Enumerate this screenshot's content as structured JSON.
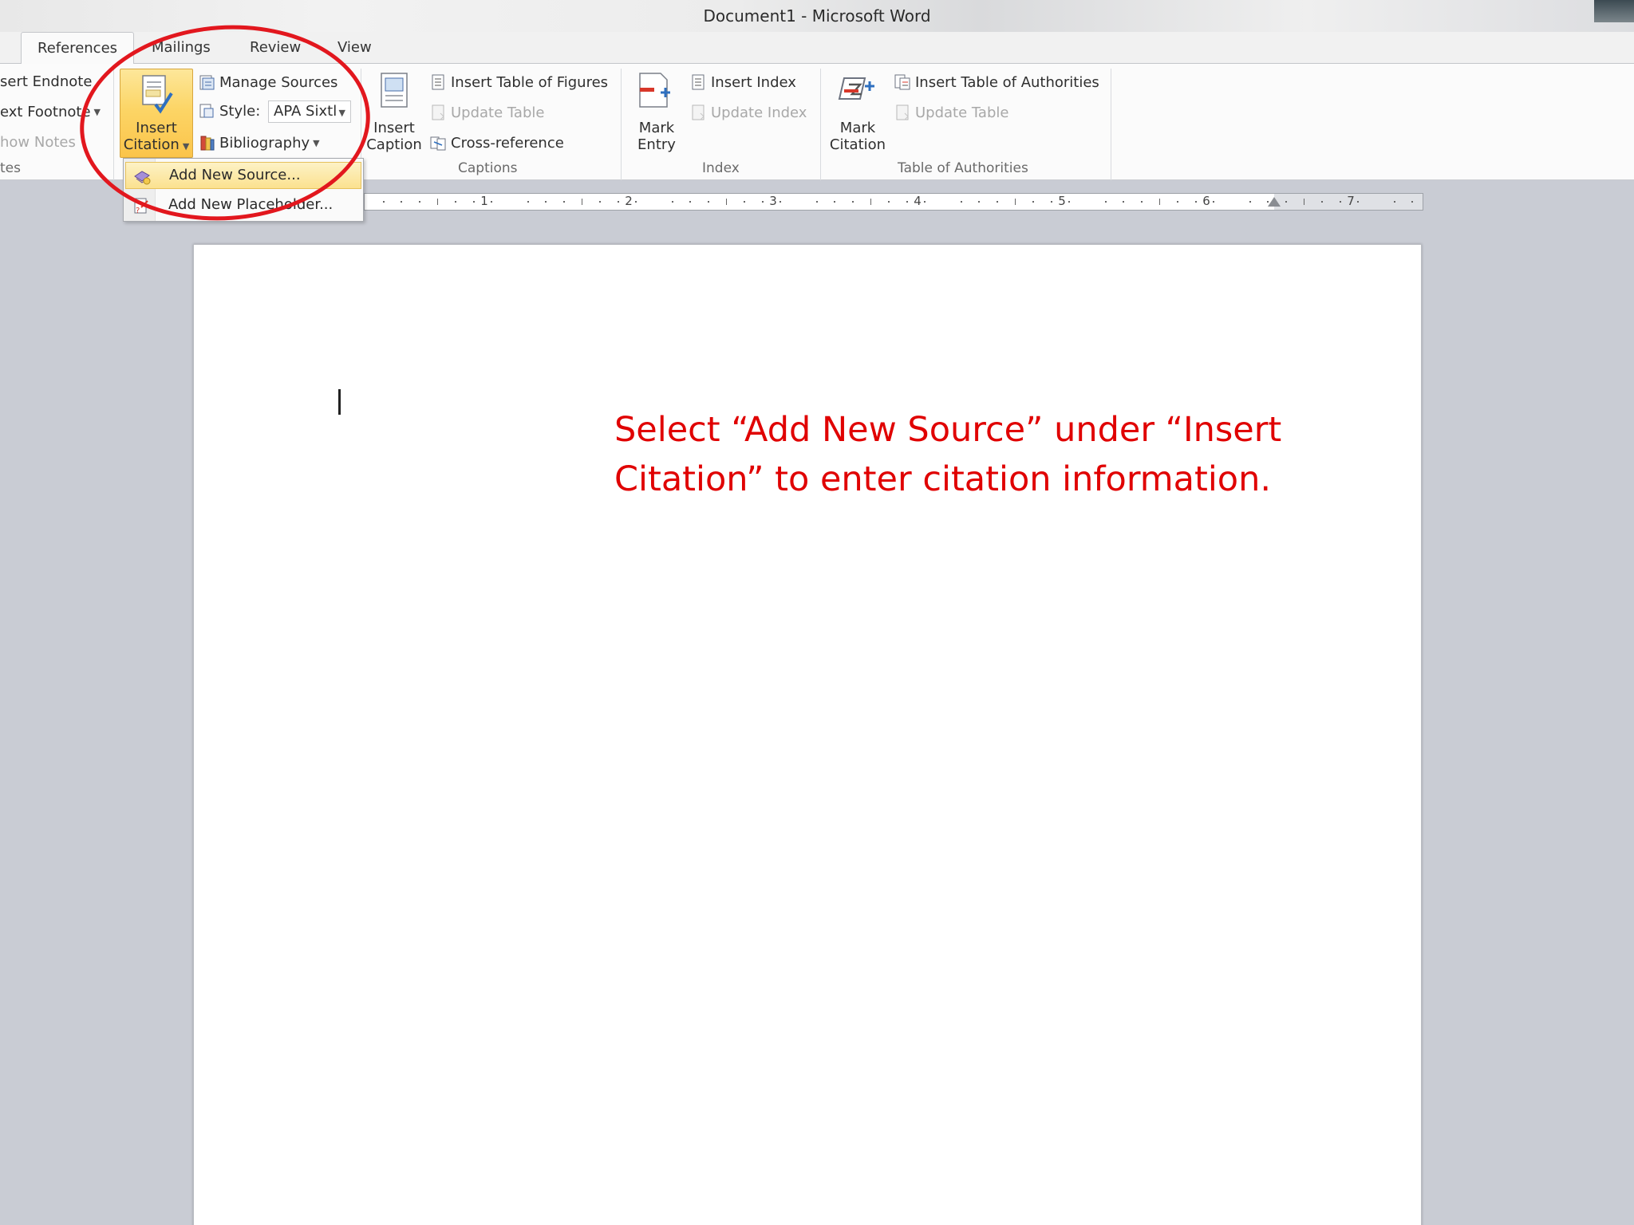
{
  "window": {
    "title": "Document1  -  Microsoft Word"
  },
  "tabs": [
    {
      "label": "References",
      "active": true
    },
    {
      "label": "Mailings",
      "active": false
    },
    {
      "label": "Review",
      "active": false
    },
    {
      "label": "View",
      "active": false
    }
  ],
  "ribbon": {
    "footnotes": {
      "insert_endnote": "sert Endnote",
      "next_footnote": "ext Footnote",
      "show_notes": "how Notes",
      "group_label": "tes"
    },
    "citations": {
      "insert_citation_line1": "Insert",
      "insert_citation_line2": "Citation",
      "manage_sources": "Manage Sources",
      "style_label": "Style:",
      "style_value": "APA Sixtl",
      "bibliography": "Bibliography"
    },
    "captions": {
      "insert_caption_line1": "Insert",
      "insert_caption_line2": "Caption",
      "insert_table_of_figures": "Insert Table of Figures",
      "update_table": "Update Table",
      "cross_reference": "Cross-reference",
      "group_label": "Captions"
    },
    "index": {
      "mark_entry_line1": "Mark",
      "mark_entry_line2": "Entry",
      "insert_index": "Insert Index",
      "update_index": "Update Index",
      "group_label": "Index"
    },
    "authorities": {
      "mark_citation_line1": "Mark",
      "mark_citation_line2": "Citation",
      "insert_table_of_authorities": "Insert Table of Authorities",
      "update_table": "Update Table",
      "group_label": "Table of Authorities"
    }
  },
  "citation_menu": {
    "add_new_source": "Add New Source...",
    "add_new_placeholder": "Add New Placeholder..."
  },
  "ruler": {
    "numbers": [
      "1",
      "2",
      "3",
      "4",
      "5",
      "6",
      "7"
    ]
  },
  "document": {
    "instruction": "Select “Add New Source” under “Insert Citation” to enter citation information."
  },
  "colors": {
    "annotation": "#e2171e",
    "instruction_text": "#e00000",
    "highlight": "#fbd564"
  }
}
